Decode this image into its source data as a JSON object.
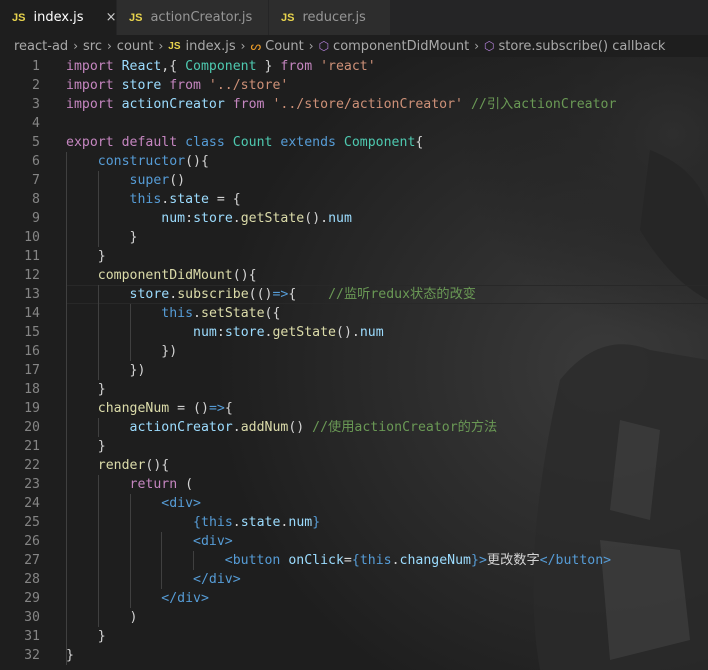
{
  "tabs": [
    {
      "badge": "JS",
      "label": "index.js",
      "close": "×",
      "active": true
    },
    {
      "badge": "JS",
      "label": "actionCreator.js",
      "active": false
    },
    {
      "badge": "JS",
      "label": "reducer.js",
      "active": false
    }
  ],
  "breadcrumb": {
    "items": [
      "react-ad",
      "src",
      "count",
      "index.js",
      "Count",
      "componentDidMount",
      "store.subscribe() callback"
    ],
    "file_badge": "JS",
    "icons": [
      "chevron-right-icon",
      "class-icon",
      "method-icon"
    ]
  },
  "editor": {
    "lines": [
      [
        [
          "kw2",
          "import "
        ],
        [
          "var",
          "React"
        ],
        [
          "pun",
          ",{ "
        ],
        [
          "cls",
          "Component"
        ],
        [
          "pun",
          " } "
        ],
        [
          "kw2",
          "from "
        ],
        [
          "str",
          "'react'"
        ]
      ],
      [
        [
          "kw2",
          "import "
        ],
        [
          "var",
          "store "
        ],
        [
          "kw2",
          "from "
        ],
        [
          "str",
          "'../store'"
        ]
      ],
      [
        [
          "kw2",
          "import "
        ],
        [
          "var",
          "actionCreator "
        ],
        [
          "kw2",
          "from "
        ],
        [
          "str",
          "'../store/actionCreator' "
        ],
        [
          "cm",
          "//引入actionCreator"
        ]
      ],
      [],
      [
        [
          "kw2",
          "export "
        ],
        [
          "kw2",
          "default "
        ],
        [
          "kw",
          "class "
        ],
        [
          "cls",
          "Count "
        ],
        [
          "kw",
          "extends "
        ],
        [
          "cls",
          "Component"
        ],
        [
          "pun",
          "{"
        ]
      ],
      [
        [
          "pun",
          "    "
        ],
        [
          "kw",
          "constructor"
        ],
        [
          "pun",
          "(){"
        ]
      ],
      [
        [
          "pun",
          "        "
        ],
        [
          "kw",
          "super"
        ],
        [
          "pun",
          "()"
        ]
      ],
      [
        [
          "pun",
          "        "
        ],
        [
          "kw",
          "this"
        ],
        [
          "pun",
          "."
        ],
        [
          "var",
          "state"
        ],
        [
          "pun",
          " = {"
        ]
      ],
      [
        [
          "pun",
          "            "
        ],
        [
          "var",
          "num"
        ],
        [
          "pun",
          ":"
        ],
        [
          "var",
          "store"
        ],
        [
          "pun",
          "."
        ],
        [
          "fn",
          "getState"
        ],
        [
          "pun",
          "()."
        ],
        [
          "var",
          "num"
        ]
      ],
      [
        [
          "pun",
          "        }"
        ]
      ],
      [
        [
          "pun",
          "    }"
        ]
      ],
      [
        [
          "pun",
          "    "
        ],
        [
          "fn",
          "componentDidMount"
        ],
        [
          "pun",
          "(){"
        ]
      ],
      [
        [
          "pun",
          "        "
        ],
        [
          "var",
          "store"
        ],
        [
          "pun",
          "."
        ],
        [
          "fn",
          "subscribe"
        ],
        [
          "pun",
          "(()"
        ],
        [
          "kw",
          "=>"
        ],
        [
          "pun",
          "{    "
        ],
        [
          "cm",
          "//监听redux状态的改变"
        ]
      ],
      [
        [
          "pun",
          "            "
        ],
        [
          "kw",
          "this"
        ],
        [
          "pun",
          "."
        ],
        [
          "fn",
          "setState"
        ],
        [
          "pun",
          "({"
        ]
      ],
      [
        [
          "pun",
          "                "
        ],
        [
          "var",
          "num"
        ],
        [
          "pun",
          ":"
        ],
        [
          "var",
          "store"
        ],
        [
          "pun",
          "."
        ],
        [
          "fn",
          "getState"
        ],
        [
          "pun",
          "()."
        ],
        [
          "var",
          "num"
        ]
      ],
      [
        [
          "pun",
          "            })"
        ]
      ],
      [
        [
          "pun",
          "        })"
        ]
      ],
      [
        [
          "pun",
          "    }"
        ]
      ],
      [
        [
          "pun",
          "    "
        ],
        [
          "fn",
          "changeNum"
        ],
        [
          "pun",
          " = ()"
        ],
        [
          "kw",
          "=>"
        ],
        [
          "pun",
          "{"
        ]
      ],
      [
        [
          "pun",
          "        "
        ],
        [
          "var",
          "actionCreator"
        ],
        [
          "pun",
          "."
        ],
        [
          "fn",
          "addNum"
        ],
        [
          "pun",
          "() "
        ],
        [
          "cm",
          "//使用actionCreator的方法"
        ]
      ],
      [
        [
          "pun",
          "    }"
        ]
      ],
      [
        [
          "pun",
          "    "
        ],
        [
          "fn",
          "render"
        ],
        [
          "pun",
          "(){"
        ]
      ],
      [
        [
          "pun",
          "        "
        ],
        [
          "kw2",
          "return"
        ],
        [
          "pun",
          " ("
        ]
      ],
      [
        [
          "pun",
          "            "
        ],
        [
          "tag",
          "<div>"
        ]
      ],
      [
        [
          "pun",
          "                "
        ],
        [
          "kw",
          "{"
        ],
        [
          "kw",
          "this"
        ],
        [
          "pun",
          "."
        ],
        [
          "var",
          "state"
        ],
        [
          "pun",
          "."
        ],
        [
          "var",
          "num"
        ],
        [
          "kw",
          "}"
        ]
      ],
      [
        [
          "pun",
          "                "
        ],
        [
          "tag",
          "<div>"
        ]
      ],
      [
        [
          "pun",
          "                    "
        ],
        [
          "tag",
          "<button "
        ],
        [
          "attr",
          "onClick"
        ],
        [
          "pun",
          "="
        ],
        [
          "kw",
          "{"
        ],
        [
          "kw",
          "this"
        ],
        [
          "pun",
          "."
        ],
        [
          "var",
          "changeNum"
        ],
        [
          "kw",
          "}"
        ],
        [
          "tag",
          ">"
        ],
        [
          "pun",
          "更改数字"
        ],
        [
          "tag",
          "</button>"
        ]
      ],
      [
        [
          "pun",
          "                "
        ],
        [
          "tag",
          "</div>"
        ]
      ],
      [
        [
          "pun",
          "            "
        ],
        [
          "tag",
          "</div>"
        ]
      ],
      [
        [
          "pun",
          "        )"
        ]
      ],
      [
        [
          "pun",
          "    }"
        ]
      ],
      [
        [
          "pun",
          "}"
        ]
      ]
    ],
    "colors": {
      "keyword": "#569cd6",
      "control": "#c586c0",
      "string": "#ce9178",
      "class": "#4ec9b0",
      "function": "#dcdcaa",
      "variable": "#9cdcfe",
      "comment": "#6a9955",
      "default": "#d4d4d4",
      "line_number": "#858585"
    }
  }
}
